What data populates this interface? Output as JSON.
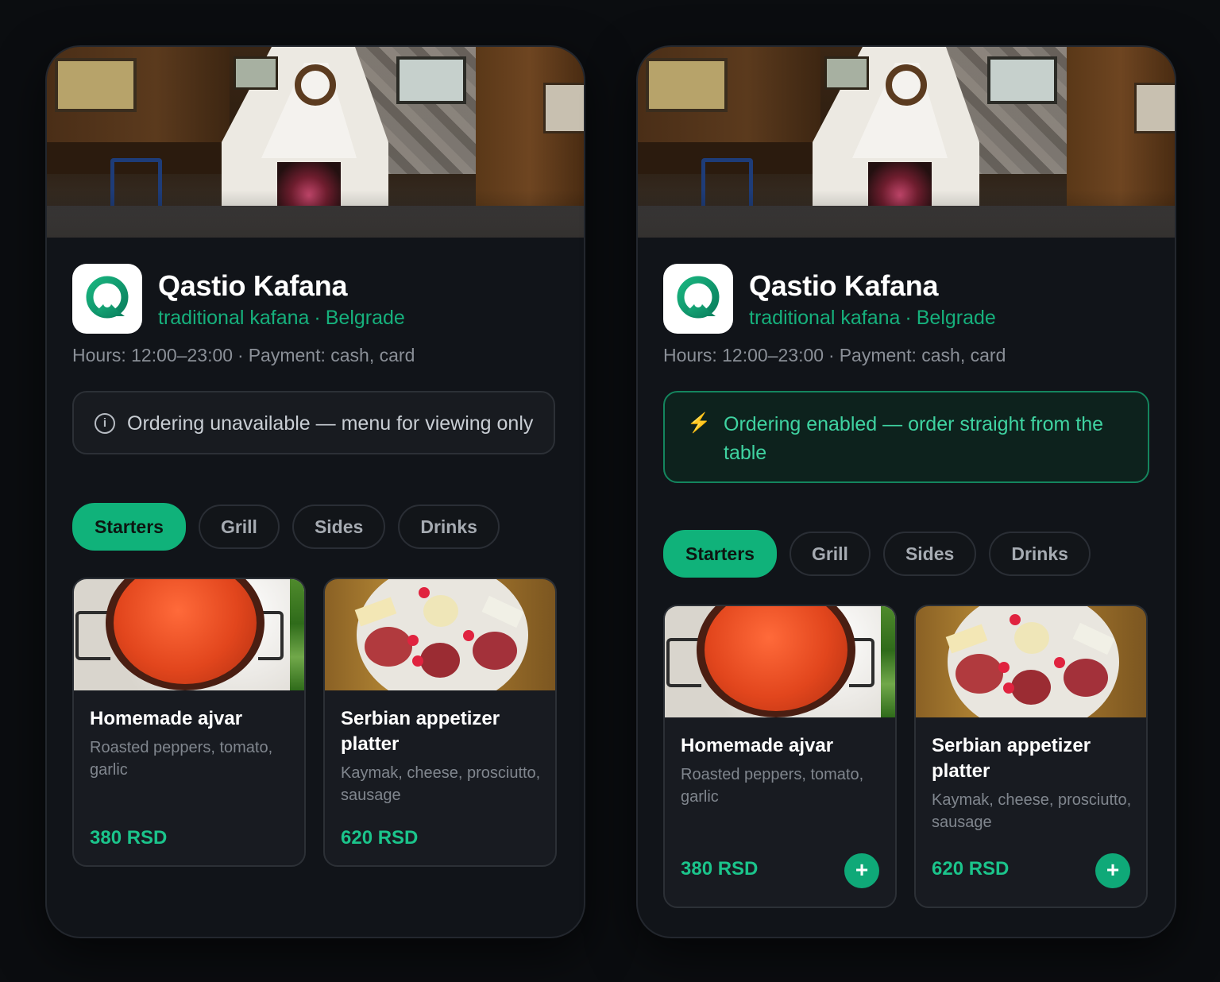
{
  "variants": [
    {
      "id": "ordering-disabled",
      "restaurant": {
        "name": "Qastio Kafana",
        "type": "traditional kafana",
        "city": "Belgrade",
        "hours": "Hours: 12:00–23:00",
        "payment": "Payment: cash, card"
      },
      "status": {
        "icon": "info-icon",
        "text": "Ordering unavailable — menu for viewing only"
      },
      "tabs": [
        {
          "label": "Starters",
          "active": true
        },
        {
          "label": "Grill",
          "active": false
        },
        {
          "label": "Sides",
          "active": false
        },
        {
          "label": "Drinks",
          "active": false
        }
      ],
      "items": [
        {
          "title": "Homemade ajvar",
          "desc": "Roasted peppers, tomato, garlic",
          "price": "380 RSD"
        },
        {
          "title": "Serbian appetizer platter",
          "desc": "Kaymak, cheese, prosciutto, sausage",
          "price": "620 RSD"
        }
      ]
    },
    {
      "id": "ordering-enabled",
      "restaurant": {
        "name": "Qastio Kafana",
        "type": "traditional kafana",
        "city": "Belgrade",
        "hours": "Hours: 12:00–23:00",
        "payment": "Payment: cash, card"
      },
      "status": {
        "icon": "lightning-icon",
        "text": "Ordering enabled — order straight from the table"
      },
      "tabs": [
        {
          "label": "Starters",
          "active": true
        },
        {
          "label": "Grill",
          "active": false
        },
        {
          "label": "Sides",
          "active": false
        },
        {
          "label": "Drinks",
          "active": false
        }
      ],
      "items": [
        {
          "title": "Homemade ajvar",
          "desc": "Roasted peppers, tomato, garlic",
          "price": "380 RSD",
          "add_label": "+"
        },
        {
          "title": "Serbian appetizer platter",
          "desc": "Kaymak, cheese, prosciutto, sausage",
          "price": "620 RSD",
          "add_label": "+"
        }
      ]
    }
  ],
  "separator": "·",
  "colors": {
    "accent": "#10b27a",
    "accent_text": "#16b07c",
    "background": "#0b0d10",
    "card": "#181b21",
    "enabled_banner_border": "#14855e",
    "lightning": "#f5b818"
  }
}
